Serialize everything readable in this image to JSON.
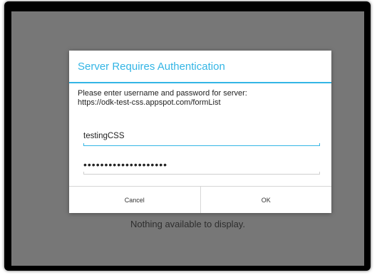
{
  "screen": {
    "empty_message": "Nothing available to display."
  },
  "dialog": {
    "title": "Server Requires Authentication",
    "message_line1": "Please enter username and password for server:",
    "message_line2": "https://odk-test-css.appspot.com/formList",
    "username_value": "testingCSS",
    "password_masked": "••••••••••••••••••••",
    "cancel_label": "Cancel",
    "ok_label": "OK"
  },
  "colors": {
    "accent": "#33b5e5",
    "screen_background": "#777777",
    "dialog_background": "#ffffff"
  }
}
